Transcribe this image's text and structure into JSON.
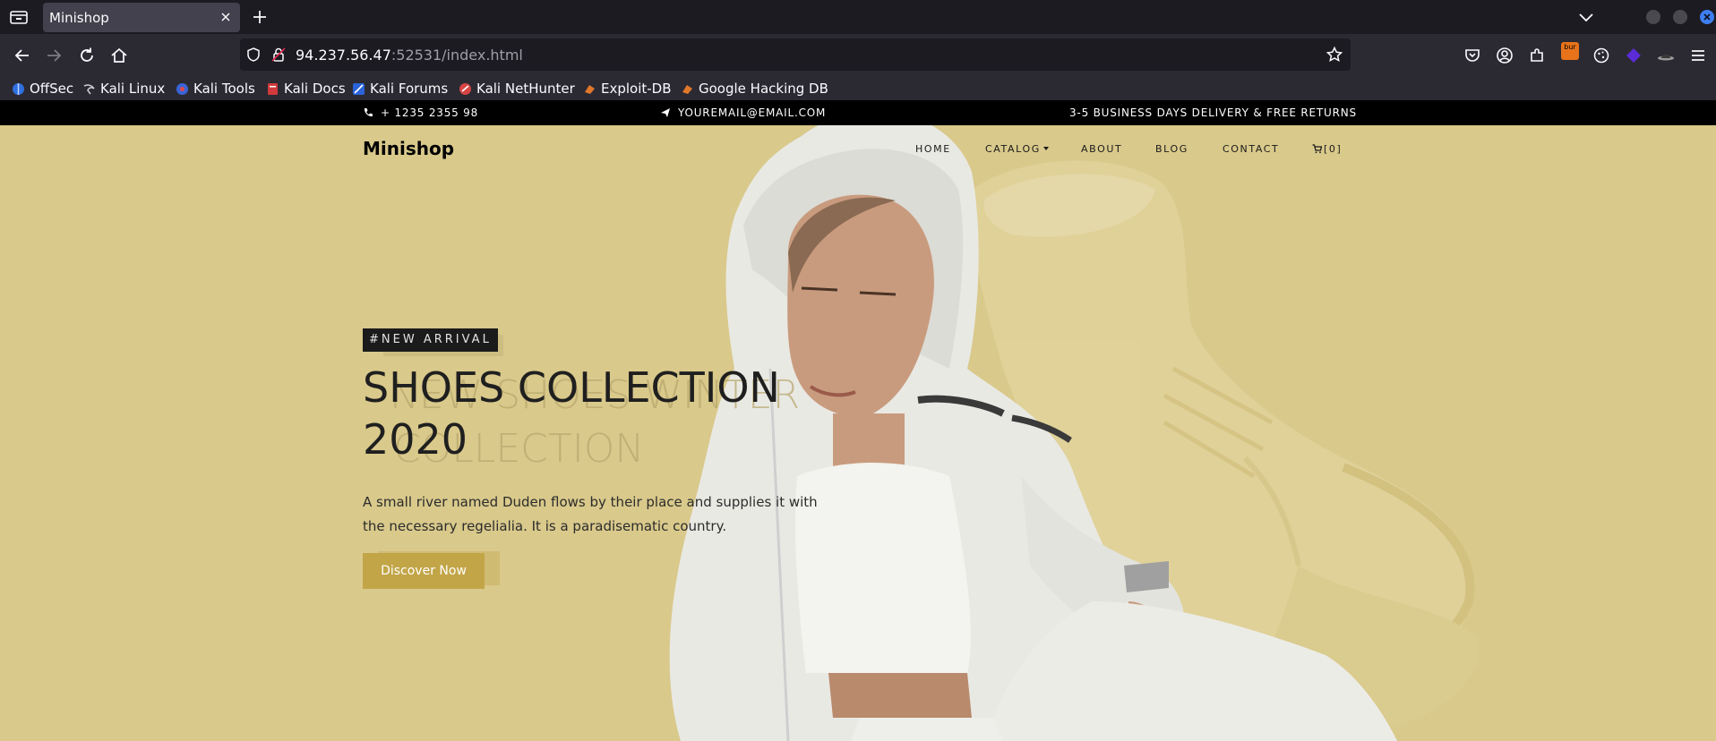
{
  "browser": {
    "tab_title": "Minishop",
    "url_host": "94.237.56.47",
    "url_rest": ":52531/index.html",
    "bookmarks": [
      {
        "label": "OffSec",
        "icon": "offsec-icon"
      },
      {
        "label": "Kali Linux",
        "icon": "kali-dragon-icon"
      },
      {
        "label": "Kali Tools",
        "icon": "kali-tools-icon"
      },
      {
        "label": "Kali Docs",
        "icon": "kali-docs-icon"
      },
      {
        "label": "Kali Forums",
        "icon": "kali-forums-icon"
      },
      {
        "label": "Kali NetHunter",
        "icon": "nethunter-icon"
      },
      {
        "label": "Exploit-DB",
        "icon": "exploit-db-icon"
      },
      {
        "label": "Google Hacking DB",
        "icon": "ghdb-icon"
      }
    ],
    "burp_badge": "bur"
  },
  "topbar": {
    "phone": "+ 1235 2355 98",
    "email": "YOUREMAIL@EMAIL.COM",
    "delivery": "3-5 BUSINESS DAYS DELIVERY & FREE RETURNS"
  },
  "site": {
    "brand": "Minishop",
    "menu": {
      "home": "HOME",
      "catalog": "CATALOG",
      "about": "ABOUT",
      "blog": "BLOG",
      "contact": "CONTACT",
      "cart": "[0]"
    }
  },
  "hero": {
    "badge": "#NEW ARRIVAL",
    "title_line1": "SHOES COLLECTION",
    "title_line2": "2020",
    "ghost_line1": "NEW SHOES WINTER",
    "ghost_line2": "COLLECTION",
    "description": "A small river named Duden flows by their place and supplies it with the necessary regelialia. It is a paradisematic country.",
    "cta": "Discover Now"
  },
  "colors": {
    "hero_bg": "#d9c98b",
    "cta_bg": "#c2a547",
    "topbar_bg": "#000000"
  }
}
